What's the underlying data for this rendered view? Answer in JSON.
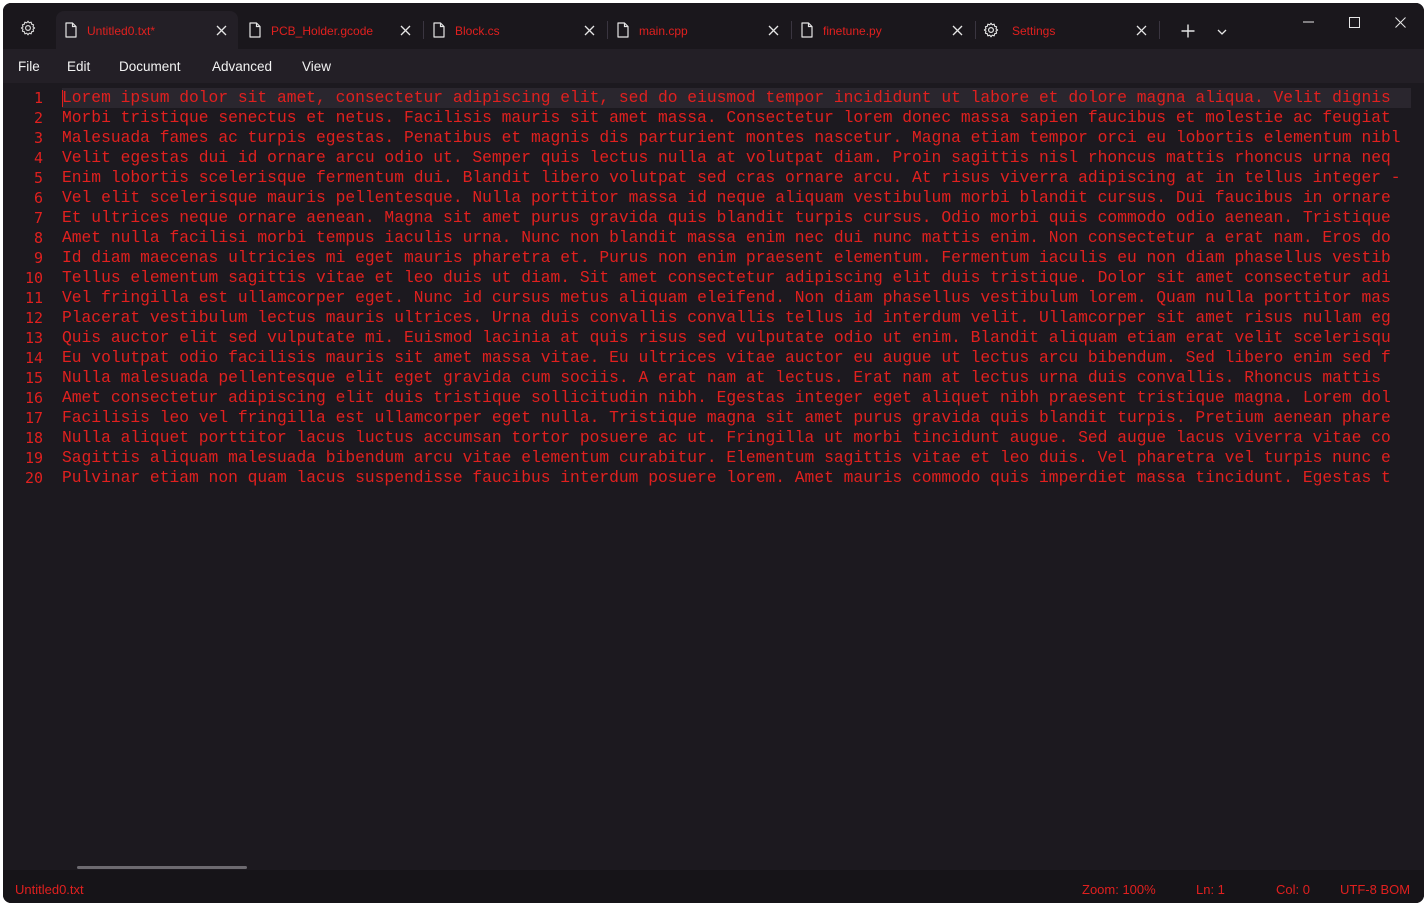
{
  "tabs": [
    {
      "label": "Untitled0.txt*",
      "icon": "file-icon",
      "active": true
    },
    {
      "label": "PCB_Holder.gcode",
      "icon": "file-icon",
      "active": false
    },
    {
      "label": "Block.cs",
      "icon": "file-icon",
      "active": false
    },
    {
      "label": "main.cpp",
      "icon": "file-icon",
      "active": false
    },
    {
      "label": "finetune.py",
      "icon": "file-icon",
      "active": false
    },
    {
      "label": "Settings",
      "icon": "gear-icon",
      "active": false
    }
  ],
  "menu": [
    "File",
    "Edit",
    "Document",
    "Advanced",
    "View"
  ],
  "editor": {
    "line_numbers": [
      "1",
      "2",
      "3",
      "4",
      "5",
      "6",
      "7",
      "8",
      "9",
      "10",
      "11",
      "12",
      "13",
      "14",
      "15",
      "16",
      "17",
      "18",
      "19",
      "20"
    ],
    "lines": [
      "Lorem ipsum dolor sit amet, consectetur adipiscing elit, sed do eiusmod tempor incididunt ut labore et dolore magna aliqua. Velit dignis",
      "Morbi tristique senectus et netus. Facilisis mauris sit amet massa. Consectetur lorem donec massa sapien faucibus et molestie ac feugiat",
      "Malesuada fames ac turpis egestas. Penatibus et magnis dis parturient montes nascetur. Magna etiam tempor orci eu lobortis elementum nibl",
      "Velit egestas dui id ornare arcu odio ut. Semper quis lectus nulla at volutpat diam. Proin sagittis nisl rhoncus mattis rhoncus urna neq",
      "Enim lobortis scelerisque fermentum dui. Blandit libero volutpat sed cras ornare arcu. At risus viverra adipiscing at in tellus integer -",
      "Vel elit scelerisque mauris pellentesque. Nulla porttitor massa id neque aliquam vestibulum morbi blandit cursus. Dui faucibus in ornare",
      "Et ultrices neque ornare aenean. Magna sit amet purus gravida quis blandit turpis cursus. Odio morbi quis commodo odio aenean. Tristique",
      "Amet nulla facilisi morbi tempus iaculis urna. Nunc non blandit massa enim nec dui nunc mattis enim. Non consectetur a erat nam. Eros do",
      "Id diam maecenas ultricies mi eget mauris pharetra et. Purus non enim praesent elementum. Fermentum iaculis eu non diam phasellus vestib",
      "Tellus elementum sagittis vitae et leo duis ut diam. Sit amet consectetur adipiscing elit duis tristique. Dolor sit amet consectetur adi",
      "Vel fringilla est ullamcorper eget. Nunc id cursus metus aliquam eleifend. Non diam phasellus vestibulum lorem. Quam nulla porttitor mas",
      "Placerat vestibulum lectus mauris ultrices. Urna duis convallis convallis tellus id interdum velit. Ullamcorper sit amet risus nullam eg",
      "Quis auctor elit sed vulputate mi. Euismod lacinia at quis risus sed vulputate odio ut enim. Blandit aliquam etiam erat velit scelerisqu",
      "Eu volutpat odio facilisis mauris sit amet massa vitae. Eu ultrices vitae auctor eu augue ut lectus arcu bibendum. Sed libero enim sed f",
      "Nulla malesuada pellentesque elit eget gravida cum sociis. A erat nam at lectus. Erat nam at lectus urna duis convallis. Rhoncus mattis",
      "Amet consectetur adipiscing elit duis tristique sollicitudin nibh. Egestas integer eget aliquet nibh praesent tristique magna. Lorem dol",
      "Facilisis leo vel fringilla est ullamcorper eget nulla. Tristique magna sit amet purus gravida quis blandit turpis. Pretium aenean phare",
      "Nulla aliquet porttitor lacus luctus accumsan tortor posuere ac ut. Fringilla ut morbi tincidunt augue. Sed augue lacus viverra vitae co",
      "Sagittis aliquam malesuada bibendum arcu vitae elementum curabitur. Elementum sagittis vitae et leo duis. Vel pharetra vel turpis nunc e",
      "Pulvinar etiam non quam lacus suspendisse faucibus interdum posuere lorem. Amet mauris commodo quis imperdiet massa tincidunt. Egestas t"
    ]
  },
  "status": {
    "filename": "Untitled0.txt",
    "zoom": "Zoom: 100%",
    "line": "Ln: 1",
    "column": "Col: 0",
    "encoding": "UTF-8 BOM"
  },
  "colors": {
    "accent": "#e0201f",
    "background": "#1c191f",
    "titlebar": "#1a171c",
    "menubar": "#231f26",
    "statusbar": "#161418"
  }
}
